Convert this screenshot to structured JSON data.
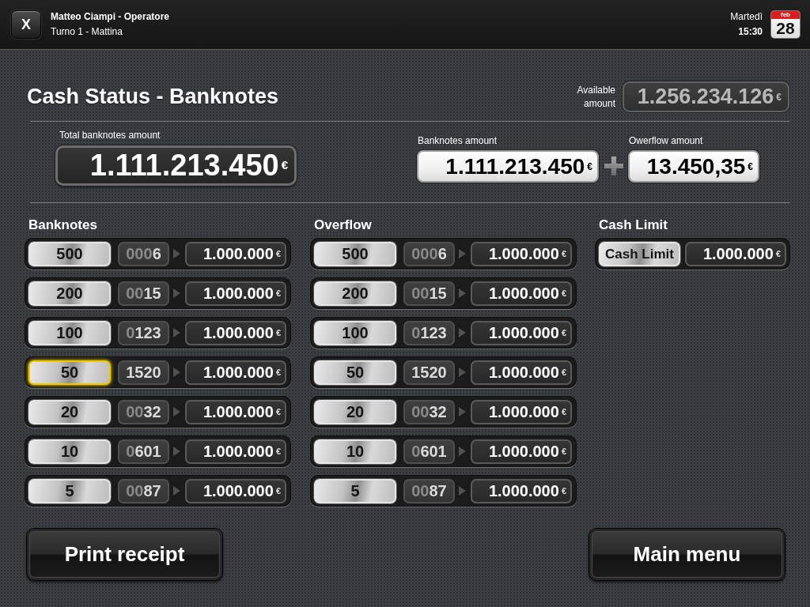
{
  "top_bar": {
    "close_button": "X",
    "operator": "Matteo Ciampi - Operatore",
    "shift": "Turno 1 - Mattina",
    "day": "Martedì",
    "time": "15:30",
    "calendar": {
      "month": "feb",
      "day": "28"
    }
  },
  "header": {
    "title": "Cash Status - Banknotes",
    "available": {
      "label": "Available amount",
      "amount": "1.256.234.126",
      "currency": "€"
    }
  },
  "totals": {
    "total": {
      "label": "Total banknotes amount",
      "amount": "1.111.213.450",
      "currency": "€"
    },
    "banknotes": {
      "label": "Banknotes amount",
      "amount": "1.111.213.450",
      "currency": "€"
    },
    "overflow": {
      "label": "Owerflow amount",
      "amount": "13.450,35",
      "currency": "€"
    }
  },
  "sections": [
    {
      "kind": "denominations",
      "title": "Banknotes",
      "rows": [
        {
          "denomination": "500",
          "count": "0006",
          "amount": "1.000.000",
          "currency": "€",
          "selected": false
        },
        {
          "denomination": "200",
          "count": "0015",
          "amount": "1.000.000",
          "currency": "€",
          "selected": false
        },
        {
          "denomination": "100",
          "count": "0123",
          "amount": "1.000.000",
          "currency": "€",
          "selected": false
        },
        {
          "denomination": "50",
          "count": "1520",
          "amount": "1.000.000",
          "currency": "€",
          "selected": true
        },
        {
          "denomination": "20",
          "count": "0032",
          "amount": "1.000.000",
          "currency": "€",
          "selected": false
        },
        {
          "denomination": "10",
          "count": "0601",
          "amount": "1.000.000",
          "currency": "€",
          "selected": false
        },
        {
          "denomination": "5",
          "count": "0087",
          "amount": "1.000.000",
          "currency": "€",
          "selected": false
        }
      ]
    },
    {
      "kind": "denominations",
      "title": "Overflow",
      "rows": [
        {
          "denomination": "500",
          "count": "0006",
          "amount": "1.000.000",
          "currency": "€",
          "selected": false
        },
        {
          "denomination": "200",
          "count": "0015",
          "amount": "1.000.000",
          "currency": "€",
          "selected": false
        },
        {
          "denomination": "100",
          "count": "0123",
          "amount": "1.000.000",
          "currency": "€",
          "selected": false
        },
        {
          "denomination": "50",
          "count": "1520",
          "amount": "1.000.000",
          "currency": "€",
          "selected": false
        },
        {
          "denomination": "20",
          "count": "0032",
          "amount": "1.000.000",
          "currency": "€",
          "selected": false
        },
        {
          "denomination": "10",
          "count": "0601",
          "amount": "1.000.000",
          "currency": "€",
          "selected": false
        },
        {
          "denomination": "5",
          "count": "0087",
          "amount": "1.000.000",
          "currency": "€",
          "selected": false
        }
      ]
    },
    {
      "kind": "limit",
      "title": "Cash Limit",
      "rows": [
        {
          "button": "Cash Limit",
          "amount": "1.000.000",
          "currency": "€",
          "selected": false
        }
      ]
    }
  ],
  "footer": {
    "buttons": [
      "Print receipt",
      "Main menu"
    ]
  }
}
